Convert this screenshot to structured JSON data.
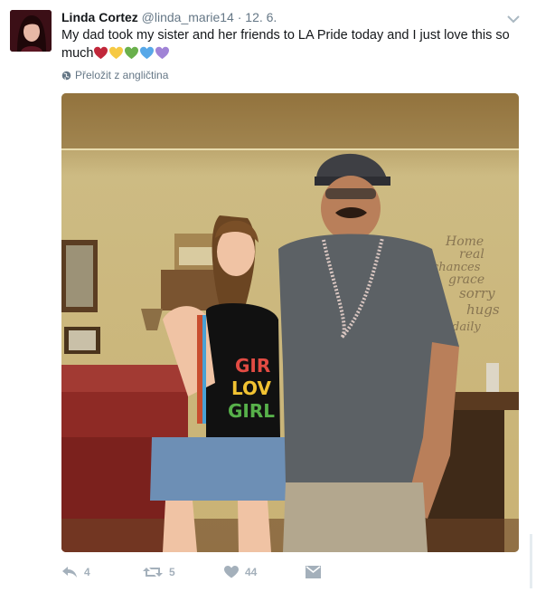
{
  "tweet": {
    "author_name": "Linda Cortez",
    "handle": "@linda_marie14",
    "separator": "·",
    "date": "12. 6.",
    "text": "My dad took my sister and her friends to LA Pride today and I just love this so much",
    "heart_colors": [
      "#c1273a",
      "#f6c944",
      "#6ab04c",
      "#58a8e8",
      "#a083d6"
    ],
    "translate_label": "Přeložit z angličtina",
    "actions": {
      "reply_count": "4",
      "retweet_count": "5",
      "like_count": "44"
    }
  },
  "icons": [
    "chevron-down-icon",
    "globe-icon",
    "reply-icon",
    "retweet-icon",
    "heart-icon",
    "direct-message-icon"
  ],
  "colors": {
    "text": "#14171a",
    "secondary": "#657786",
    "action_icon": "#a4b0bb"
  }
}
